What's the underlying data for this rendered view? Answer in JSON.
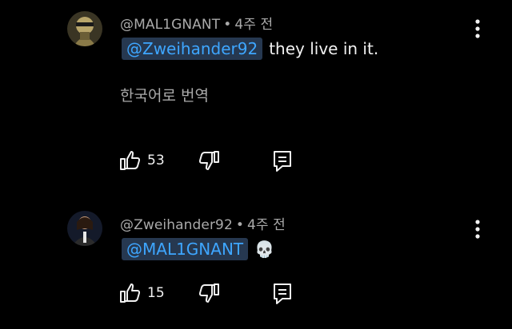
{
  "colors": {
    "background": "#000000",
    "text": "#f1f1f1",
    "meta_text": "#aaaaaa",
    "mention_text": "#3ea6ff",
    "mention_bg": "#263850"
  },
  "comments": [
    {
      "author": "@MAL1GNANT",
      "separator": "•",
      "time": "4주 전",
      "mention": "@Zweihander92",
      "text": "they live in it.",
      "translate_label": "한국어로 번역",
      "like_count": "53",
      "icons": [
        "avatar",
        "like-icon",
        "dislike-icon",
        "reply-icon",
        "more-vert-icon"
      ]
    },
    {
      "author": "@Zweihander92",
      "separator": "•",
      "time": "4주 전",
      "mention": "@MAL1GNANT",
      "emoji": "💀",
      "like_count": "15",
      "icons": [
        "avatar",
        "like-icon",
        "dislike-icon",
        "reply-icon",
        "more-vert-icon"
      ]
    }
  ]
}
